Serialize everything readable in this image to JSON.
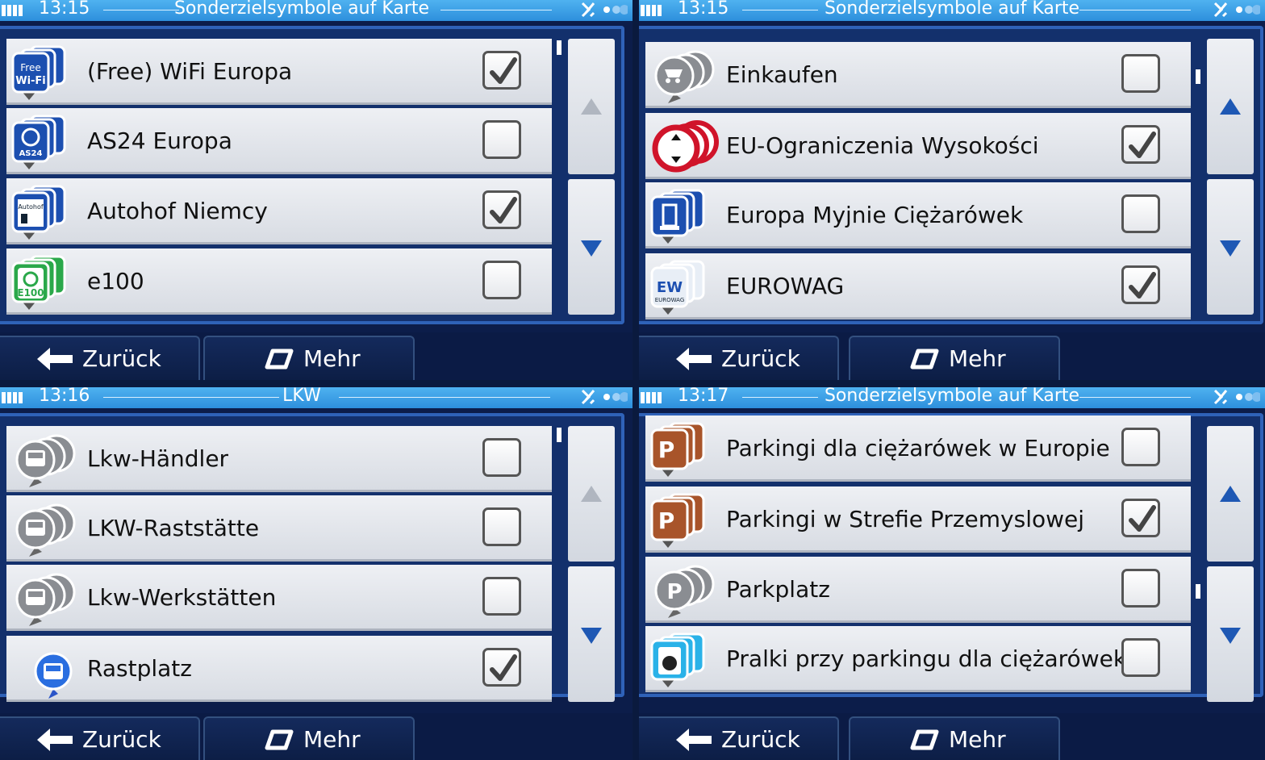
{
  "panels": [
    {
      "clock": "13:15",
      "title": "Sonderzielsymbole auf Karte",
      "items": [
        {
          "label": "(Free) WiFi Europa",
          "checked": true,
          "icon": "wifi-icon"
        },
        {
          "label": "AS24 Europa",
          "checked": false,
          "icon": "as24-icon"
        },
        {
          "label": "Autohof Niemcy",
          "checked": true,
          "icon": "autohof-icon"
        },
        {
          "label": "e100",
          "checked": false,
          "icon": "e100-icon"
        }
      ],
      "up_active": false,
      "buttons": {
        "back": "Zurück",
        "more": "Mehr"
      }
    },
    {
      "clock": "13:15",
      "title": "Sonderzielsymbole auf Karte",
      "items": [
        {
          "label": "Einkaufen",
          "checked": false,
          "icon": "shopping-cart-icon"
        },
        {
          "label": "EU-Ograniczenia Wysokości",
          "checked": true,
          "icon": "height-limit-icon"
        },
        {
          "label": "Europa Myjnie Ciężarówek",
          "checked": false,
          "icon": "truck-wash-icon"
        },
        {
          "label": "EUROWAG",
          "checked": true,
          "icon": "eurowag-icon"
        }
      ],
      "up_active": true,
      "buttons": {
        "back": "Zurück",
        "more": "Mehr"
      }
    },
    {
      "clock": "13:16",
      "title": "LKW",
      "items": [
        {
          "label": "Lkw-Händler",
          "checked": false,
          "icon": "truck-icon"
        },
        {
          "label": "LKW-Raststätte",
          "checked": false,
          "icon": "truck-icon"
        },
        {
          "label": "Lkw-Werkstätten",
          "checked": false,
          "icon": "truck-icon"
        },
        {
          "label": "Rastplatz",
          "checked": true,
          "icon": "rest-area-icon"
        }
      ],
      "up_active": false,
      "buttons": {
        "back": "Zurück",
        "more": "Mehr"
      }
    },
    {
      "clock": "13:17",
      "title": "Sonderzielsymbole auf Karte",
      "items": [
        {
          "label": "Parkingi dla ciężarówek w Europie",
          "checked": false,
          "icon": "truck-parking-icon"
        },
        {
          "label": "Parkingi w Strefie Przemyslowej",
          "checked": true,
          "icon": "industrial-parking-icon"
        },
        {
          "label": "Parkplatz",
          "checked": false,
          "icon": "parking-icon"
        },
        {
          "label": "Pralki przy parkingu dla ciężarówek",
          "checked": false,
          "icon": "laundry-icon"
        }
      ],
      "up_active": true,
      "buttons": {
        "back": "Zurück",
        "more": "Mehr"
      }
    }
  ],
  "colors": {
    "status_bar": "#3da1e6",
    "frame": "#2f62b8",
    "arrow_active": "#1e58b4",
    "arrow_inactive": "#b0b6c0"
  }
}
